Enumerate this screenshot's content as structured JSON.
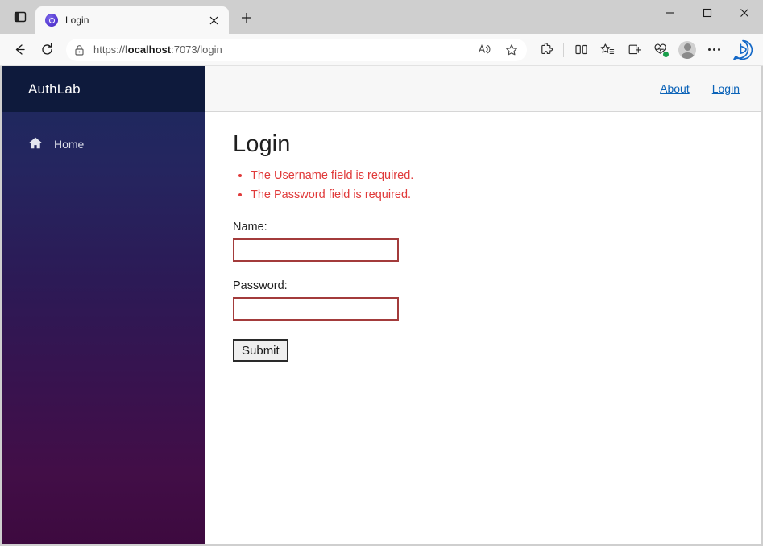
{
  "browser": {
    "tab_actions_icon": "tab-actions-icon",
    "tab": {
      "title": "Login",
      "favicon": "aspnet-favicon",
      "close_icon": "close-icon"
    },
    "new_tab_icon": "plus-icon",
    "window_controls": {
      "minimize": "minimize-icon",
      "maximize": "maximize-icon",
      "close": "close-icon"
    },
    "nav": {
      "back_icon": "back-arrow-icon",
      "reload_icon": "reload-icon"
    },
    "omnibox": {
      "lock_icon": "lock-icon",
      "url_scheme": "https://",
      "url_host": "localhost",
      "url_path": ":7073/login",
      "read_aloud_icon": "read-aloud-icon",
      "favorite_icon": "star-icon"
    },
    "toolbar": {
      "extensions_icon": "extensions-puzzle-icon",
      "split_screen_icon": "split-screen-icon",
      "favorites_icon": "favorites-star-list-icon",
      "collections_icon": "collections-icon",
      "browser_essentials_icon": "browser-essentials-icon",
      "profile_icon": "profile-avatar-icon",
      "settings_icon": "settings-ellipsis-icon",
      "copilot_icon": "copilot-bing-icon"
    }
  },
  "page": {
    "brand": "AuthLab",
    "sidebar": {
      "items": [
        {
          "label": "Home",
          "icon": "home-icon"
        }
      ]
    },
    "topnav": {
      "links": [
        {
          "label": "About"
        },
        {
          "label": "Login"
        }
      ]
    },
    "main": {
      "title": "Login",
      "validation_errors": [
        "The Username field is required.",
        "The Password field is required."
      ],
      "fields": [
        {
          "label": "Name:",
          "value": "",
          "placeholder": ""
        },
        {
          "label": "Password:",
          "value": "",
          "placeholder": ""
        }
      ],
      "submit_label": "Submit"
    }
  },
  "colors": {
    "brand_header": "#0e1a3c",
    "sidebar_top": "#1b2a5e",
    "sidebar_bottom": "#3d0a3f",
    "link": "#0b63b8",
    "error": "#e03a3a",
    "field_border_invalid": "#a33b3b"
  }
}
